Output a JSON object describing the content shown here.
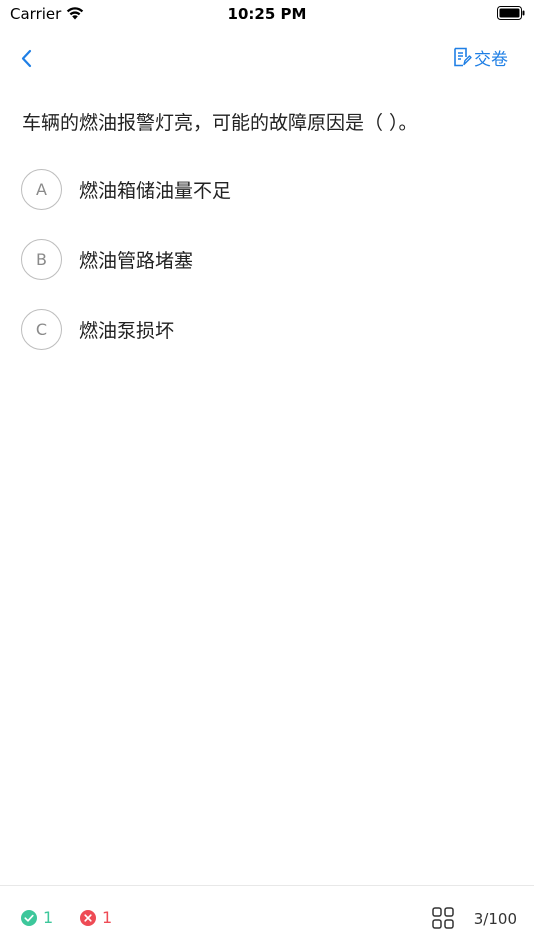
{
  "status_bar": {
    "carrier": "Carrier",
    "time": "10:25 PM"
  },
  "nav": {
    "submit_label": "交卷",
    "back_icon": "chevron-left-icon",
    "submit_icon": "paper-submit-icon"
  },
  "question": {
    "text": "车辆的燃油报警灯亮，可能的故障原因是（ ）。",
    "options": [
      {
        "letter": "A",
        "text": "燃油箱储油量不足"
      },
      {
        "letter": "B",
        "text": "燃油管路堵塞"
      },
      {
        "letter": "C",
        "text": "燃油泵损坏"
      }
    ]
  },
  "footer": {
    "correct_count": "1",
    "wrong_count": "1",
    "progress": "3/100"
  },
  "colors": {
    "accent": "#1f7fe5",
    "correct": "#3dc79b",
    "wrong": "#ee4b55"
  }
}
